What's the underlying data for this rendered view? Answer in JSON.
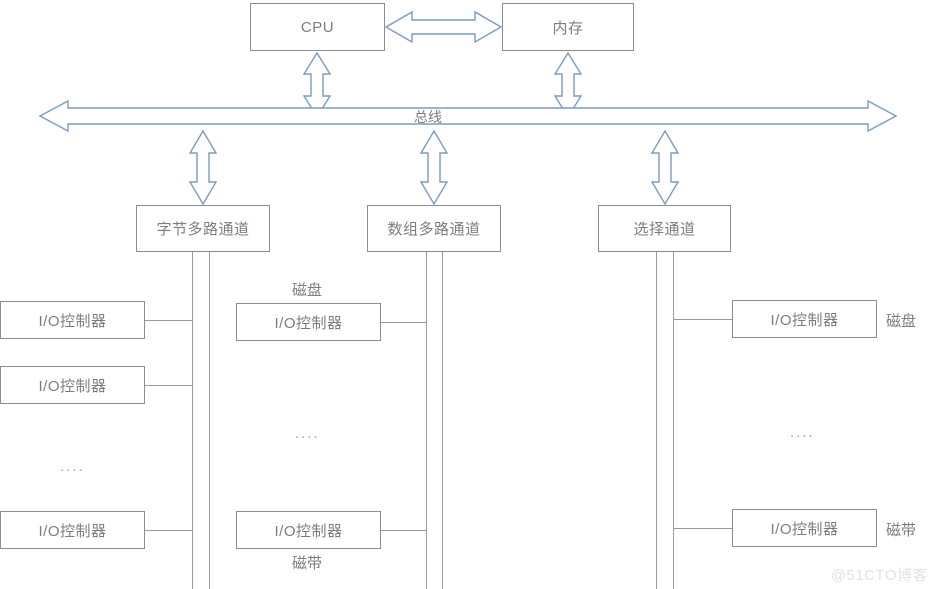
{
  "diagram": {
    "title_nodes": {
      "cpu": "CPU",
      "memory": "内存",
      "bus": "总线"
    },
    "channels": [
      {
        "id": "byte-multiplex",
        "label": "字节多路通道"
      },
      {
        "id": "array-multiplex",
        "label": "数组多路通道"
      },
      {
        "id": "select-channel",
        "label": "选择通道"
      }
    ],
    "controllers": {
      "left": [
        {
          "label": "I/O控制器"
        },
        {
          "label": "I/O控制器"
        },
        {
          "label": "I/O控制器"
        }
      ],
      "middle": [
        {
          "label": "I/O控制器"
        },
        {
          "label": "I/O控制器"
        }
      ],
      "right": [
        {
          "label": "I/O控制器"
        },
        {
          "label": "I/O控制器"
        }
      ]
    },
    "device_labels": {
      "middle_top": "磁盘",
      "middle_bottom": "磁带",
      "right_top": "磁盘",
      "right_bottom": "磁带"
    },
    "ellipses": {
      "left": "....",
      "middle": "....",
      "right": "...."
    },
    "watermark": "@51CTO博客",
    "colors": {
      "box_border": "#8c8c8c",
      "text": "#7d7d7d",
      "arrow_stroke": "#7b9bc4",
      "line": "#9a9a9a",
      "watermark": "#e2e2e2"
    }
  }
}
